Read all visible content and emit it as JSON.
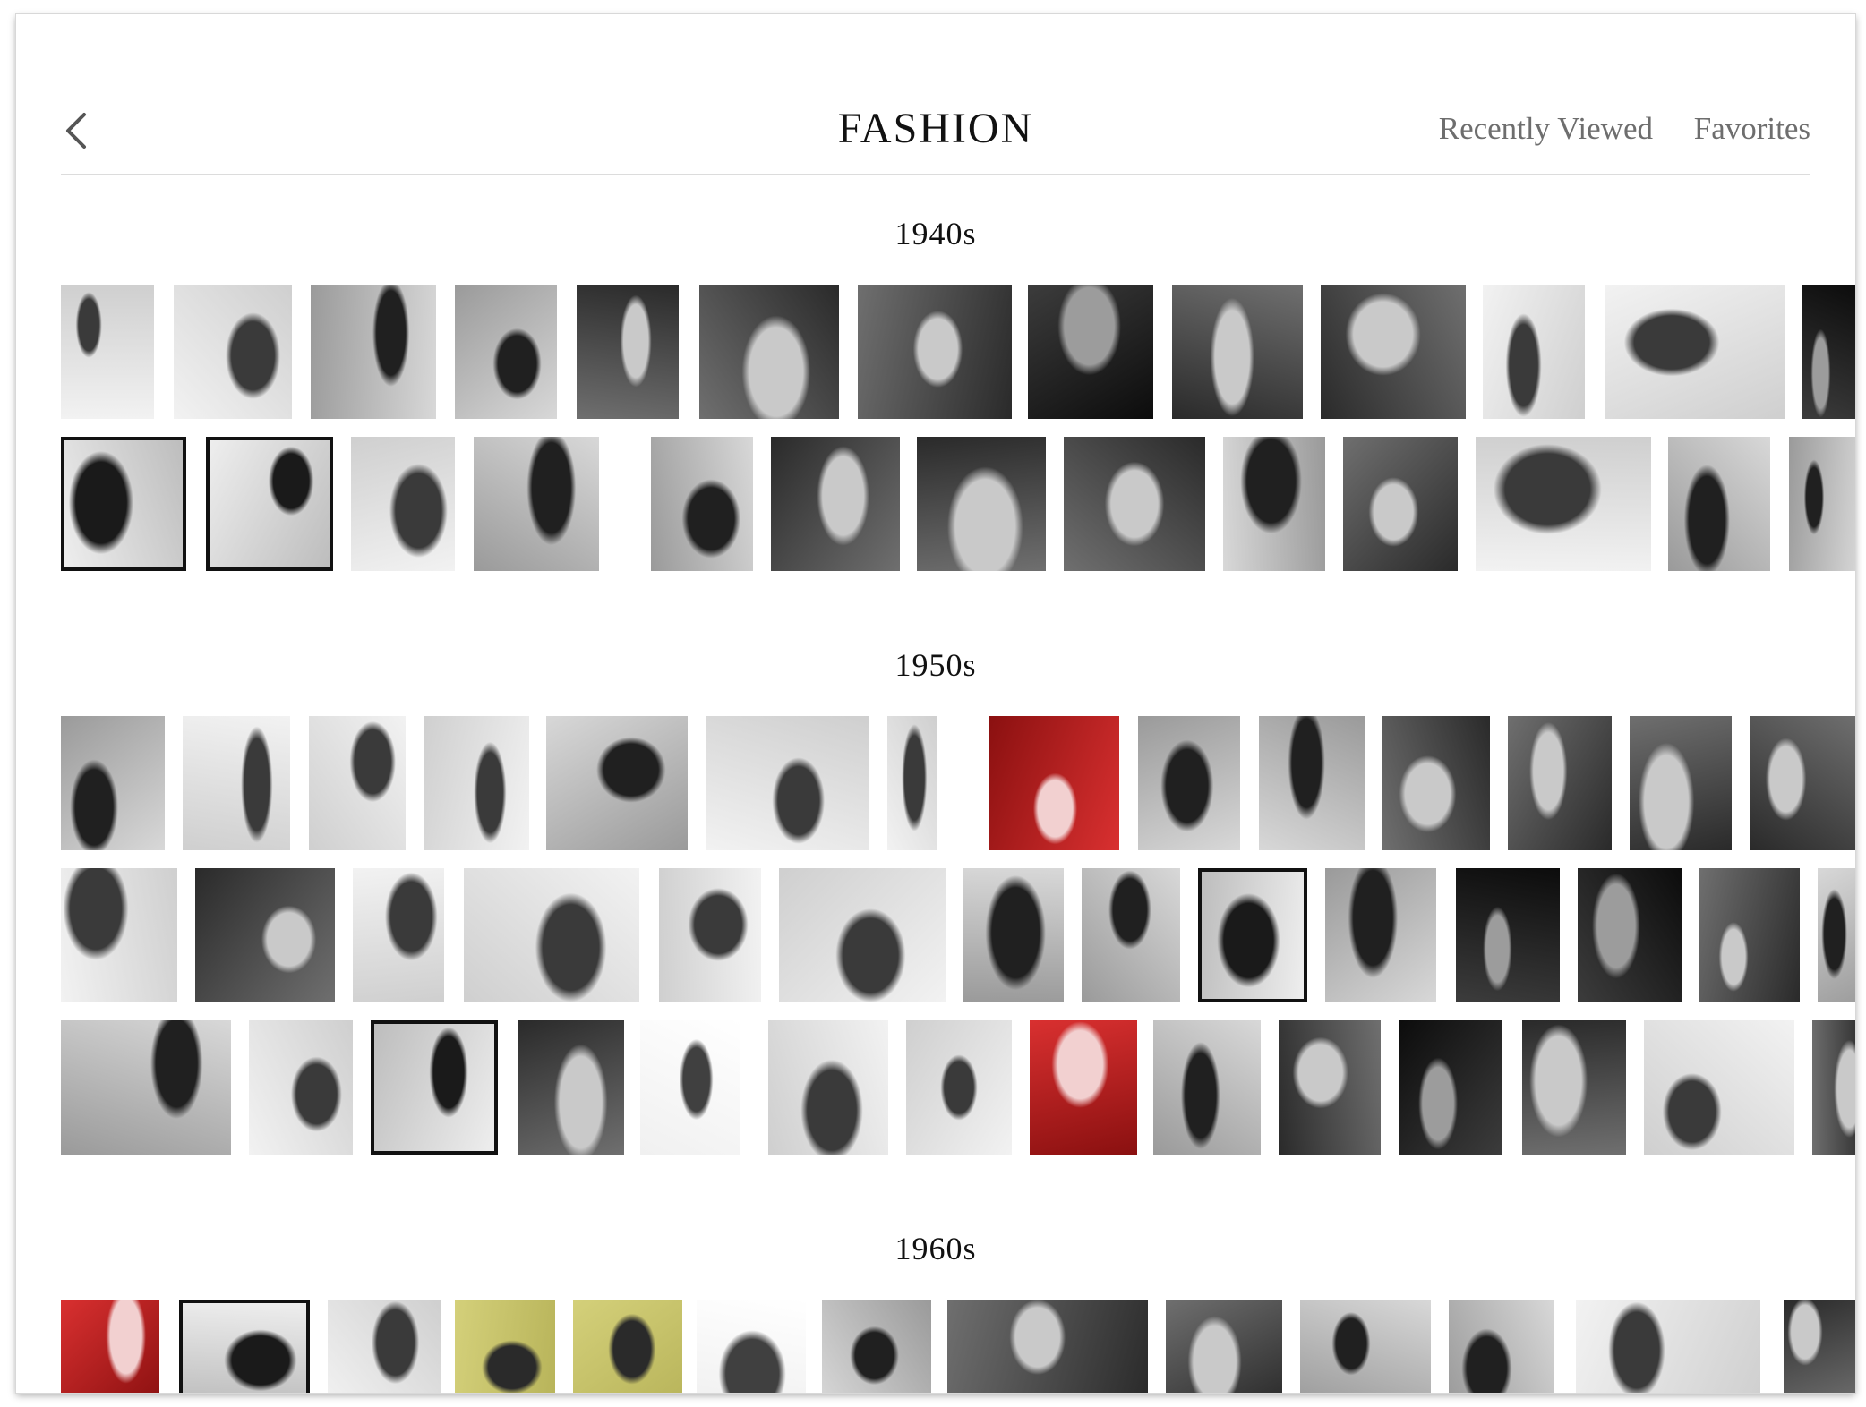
{
  "header": {
    "back_icon": "chevron-left-icon",
    "title": "FASHION",
    "nav": {
      "recently_viewed": "Recently Viewed",
      "favorites": "Favorites"
    }
  },
  "colors": {
    "background": "#ffffff",
    "title_text": "#111111",
    "nav_text": "#6e6e6e",
    "divider": "#dcdcdc"
  },
  "sections": [
    {
      "heading": "1940s",
      "rows": 2
    },
    {
      "heading": "1950s",
      "rows": 3
    },
    {
      "heading": "1960s",
      "rows": 1
    }
  ]
}
